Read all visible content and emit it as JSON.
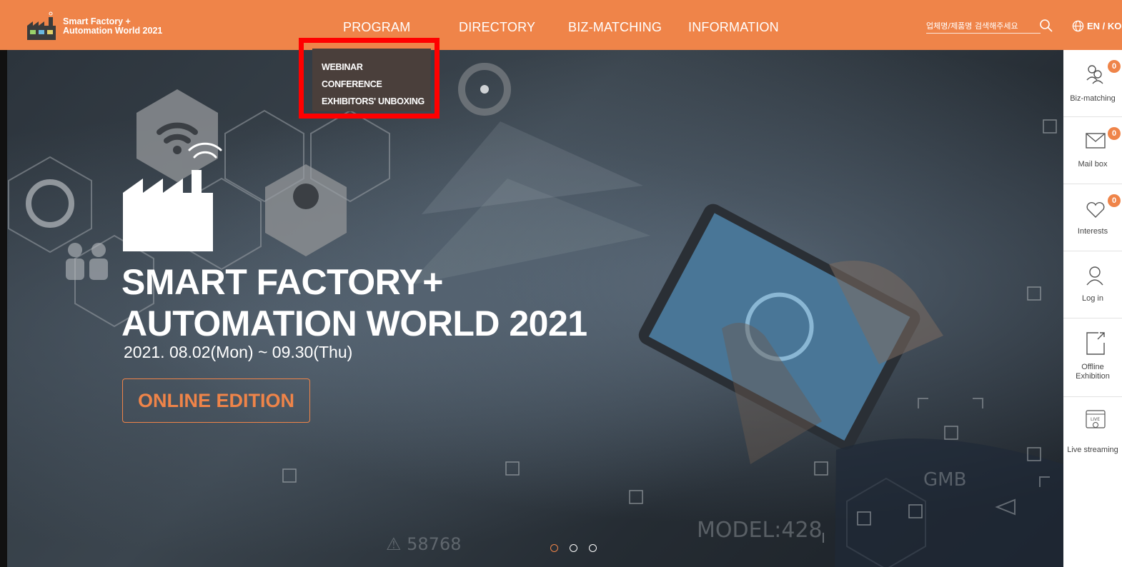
{
  "header": {
    "logo_line1": "Smart Factory +",
    "logo_line2": "Automation World 2021",
    "nav": [
      "PROGRAM",
      "DIRECTORY",
      "BIZ-MATCHING",
      "INFORMATION"
    ],
    "search_placeholder": "업체명/제품명 검색해주세요",
    "lang": "EN / KO"
  },
  "dropdown": {
    "items": [
      "WEBINAR",
      "CONFERENCE",
      "EXHIBITORS' UNBOXING"
    ]
  },
  "hero": {
    "title_line1": "SMART FACTORY+",
    "title_line2": "AUTOMATION WORLD 2021",
    "date": "2021. 08.02(Mon) ~ 09.30(Thu)",
    "button": "ONLINE EDITION"
  },
  "sidebar": {
    "items": [
      {
        "label": "Biz-matching",
        "badge": "0",
        "icon": "handshake-icon"
      },
      {
        "label": "Mail box",
        "badge": "0",
        "icon": "mail-icon"
      },
      {
        "label": "Interests",
        "badge": "0",
        "icon": "heart-icon"
      },
      {
        "label": "Log in",
        "icon": "user-icon"
      },
      {
        "label": "Offline Exhibition",
        "icon": "external-link-icon"
      },
      {
        "label": "Live streaming",
        "icon": "live-icon"
      }
    ]
  },
  "colors": {
    "accent": "#ef8449",
    "highlight": "#ff0000",
    "dropdown_bg": "#4a3f3b"
  }
}
